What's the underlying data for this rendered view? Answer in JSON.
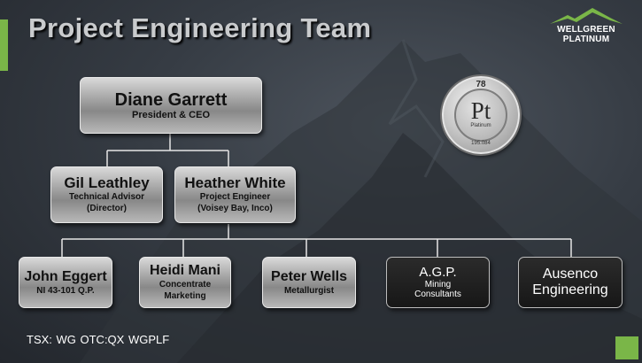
{
  "title": "Project Engineering Team",
  "logo": {
    "line1": "WELLGREEN",
    "line2": "PLATINUM"
  },
  "element_coin": {
    "number": "78",
    "symbol": "Pt",
    "name": "Platinum",
    "weight": "195.084"
  },
  "org": {
    "root": {
      "name": "Diane Garrett",
      "role": "President & CEO"
    },
    "level2": [
      {
        "name": "Gil Leathley",
        "role1": "Technical Advisor",
        "role2": "(Director)"
      },
      {
        "name": "Heather White",
        "role1": "Project Engineer",
        "role2": "(Voisey Bay, Inco)"
      }
    ],
    "level3": [
      {
        "name": "John Eggert",
        "role1": "NI 43-101 Q.P."
      },
      {
        "name": "Heidi Mani",
        "role1": "Concentrate",
        "role2": "Marketing"
      },
      {
        "name": "Peter Wells",
        "role1": "Metallurgist"
      },
      {
        "name": "A.G.P.",
        "role1": "Mining",
        "role2": "Consultants"
      },
      {
        "name": "Ausenco",
        "name2": "Engineering"
      }
    ]
  },
  "footer": {
    "ticker": "TSX:  WG   OTC:QX  WGPLF"
  },
  "colors": {
    "accent": "#7ab648",
    "background": "#363c44"
  }
}
